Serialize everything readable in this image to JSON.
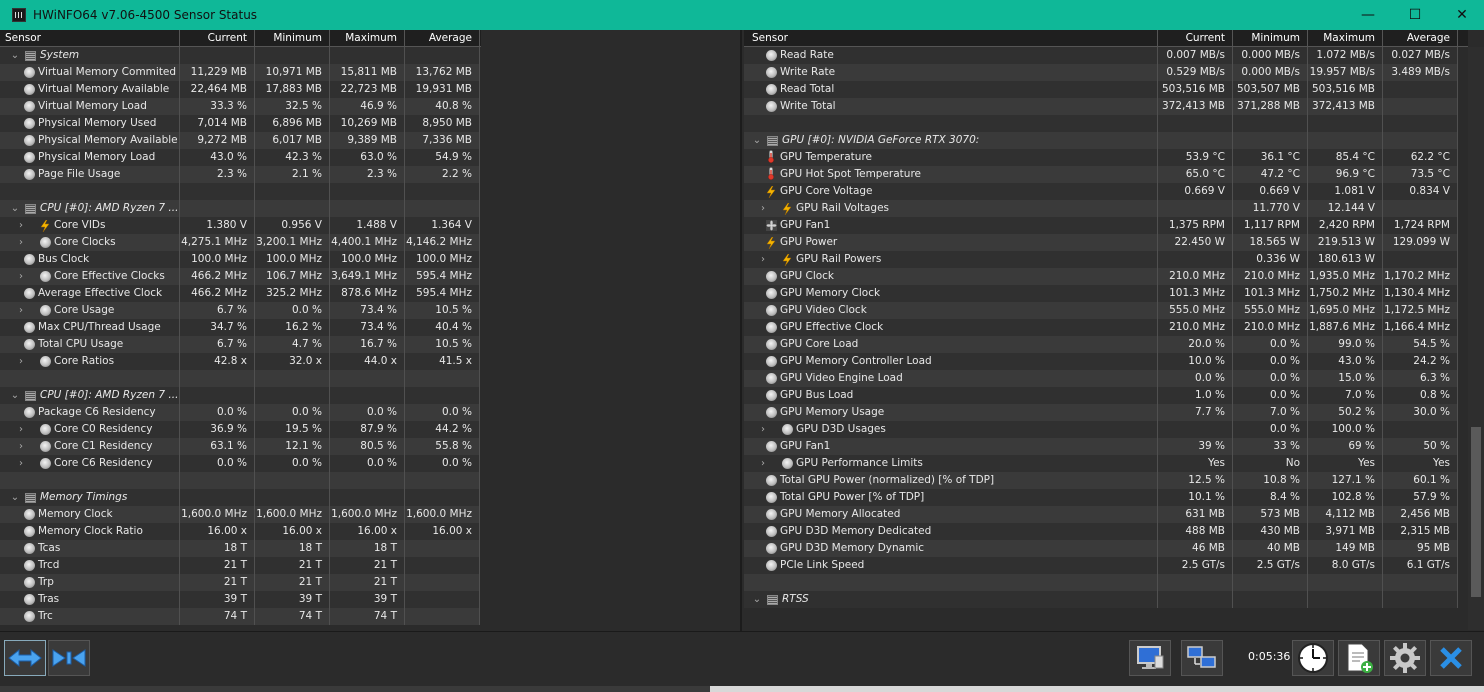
{
  "window": {
    "title": "HWiNFO64 v7.06-4500 Sensor Status",
    "minimize": "—",
    "maximize": "☐",
    "close": "✕"
  },
  "columns": {
    "sensor": "Sensor",
    "current": "Current",
    "minimum": "Minimum",
    "maximum": "Maximum",
    "average": "Average"
  },
  "left_rows": [
    {
      "type": "group",
      "name": "System"
    },
    {
      "type": "item",
      "icon": "clock",
      "name": "Virtual Memory Commited",
      "cur": "11,229 MB",
      "min": "10,971 MB",
      "max": "15,811 MB",
      "avg": "13,762 MB"
    },
    {
      "type": "item",
      "icon": "clock",
      "name": "Virtual Memory Available",
      "cur": "22,464 MB",
      "min": "17,883 MB",
      "max": "22,723 MB",
      "avg": "19,931 MB"
    },
    {
      "type": "item",
      "icon": "clock",
      "name": "Virtual Memory Load",
      "cur": "33.3 %",
      "min": "32.5 %",
      "max": "46.9 %",
      "avg": "40.8 %"
    },
    {
      "type": "item",
      "icon": "clock",
      "name": "Physical Memory Used",
      "cur": "7,014 MB",
      "min": "6,896 MB",
      "max": "10,269 MB",
      "avg": "8,950 MB"
    },
    {
      "type": "item",
      "icon": "clock",
      "name": "Physical Memory Available",
      "cur": "9,272 MB",
      "min": "6,017 MB",
      "max": "9,389 MB",
      "avg": "7,336 MB"
    },
    {
      "type": "item",
      "icon": "clock",
      "name": "Physical Memory Load",
      "cur": "43.0 %",
      "min": "42.3 %",
      "max": "63.0 %",
      "avg": "54.9 %"
    },
    {
      "type": "item",
      "icon": "clock",
      "name": "Page File Usage",
      "cur": "2.3 %",
      "min": "2.1 %",
      "max": "2.3 %",
      "avg": "2.2 %"
    },
    {
      "type": "blank"
    },
    {
      "type": "group",
      "name": "CPU [#0]: AMD Ryzen 7 ..."
    },
    {
      "type": "sub",
      "icon": "bolt",
      "name": "Core VIDs",
      "cur": "1.380 V",
      "min": "0.956 V",
      "max": "1.488 V",
      "avg": "1.364 V"
    },
    {
      "type": "sub",
      "icon": "clock",
      "name": "Core Clocks",
      "cur": "4,275.1 MHz",
      "min": "3,200.1 MHz",
      "max": "4,400.1 MHz",
      "avg": "4,146.2 MHz"
    },
    {
      "type": "item",
      "icon": "clock",
      "name": "Bus Clock",
      "cur": "100.0 MHz",
      "min": "100.0 MHz",
      "max": "100.0 MHz",
      "avg": "100.0 MHz"
    },
    {
      "type": "sub",
      "icon": "clock",
      "name": "Core Effective Clocks",
      "cur": "466.2 MHz",
      "min": "106.7 MHz",
      "max": "3,649.1 MHz",
      "avg": "595.4 MHz"
    },
    {
      "type": "item",
      "icon": "clock",
      "name": "Average Effective Clock",
      "cur": "466.2 MHz",
      "min": "325.2 MHz",
      "max": "878.6 MHz",
      "avg": "595.4 MHz"
    },
    {
      "type": "sub",
      "icon": "clock",
      "name": "Core Usage",
      "cur": "6.7 %",
      "min": "0.0 %",
      "max": "73.4 %",
      "avg": "10.5 %"
    },
    {
      "type": "item",
      "icon": "clock",
      "name": "Max CPU/Thread Usage",
      "cur": "34.7 %",
      "min": "16.2 %",
      "max": "73.4 %",
      "avg": "40.4 %"
    },
    {
      "type": "item",
      "icon": "clock",
      "name": "Total CPU Usage",
      "cur": "6.7 %",
      "min": "4.7 %",
      "max": "16.7 %",
      "avg": "10.5 %"
    },
    {
      "type": "sub",
      "icon": "clock",
      "name": "Core Ratios",
      "cur": "42.8 x",
      "min": "32.0 x",
      "max": "44.0 x",
      "avg": "41.5 x"
    },
    {
      "type": "blank"
    },
    {
      "type": "group",
      "name": "CPU [#0]: AMD Ryzen 7 ..."
    },
    {
      "type": "item",
      "icon": "clock",
      "name": "Package C6 Residency",
      "cur": "0.0 %",
      "min": "0.0 %",
      "max": "0.0 %",
      "avg": "0.0 %"
    },
    {
      "type": "sub",
      "icon": "clock",
      "name": "Core C0 Residency",
      "cur": "36.9 %",
      "min": "19.5 %",
      "max": "87.9 %",
      "avg": "44.2 %"
    },
    {
      "type": "sub",
      "icon": "clock",
      "name": "Core C1 Residency",
      "cur": "63.1 %",
      "min": "12.1 %",
      "max": "80.5 %",
      "avg": "55.8 %"
    },
    {
      "type": "sub",
      "icon": "clock",
      "name": "Core C6 Residency",
      "cur": "0.0 %",
      "min": "0.0 %",
      "max": "0.0 %",
      "avg": "0.0 %"
    },
    {
      "type": "blank"
    },
    {
      "type": "group",
      "name": "Memory Timings"
    },
    {
      "type": "item",
      "icon": "clock",
      "name": "Memory Clock",
      "cur": "1,600.0 MHz",
      "min": "1,600.0 MHz",
      "max": "1,600.0 MHz",
      "avg": "1,600.0 MHz"
    },
    {
      "type": "item",
      "icon": "clock",
      "name": "Memory Clock Ratio",
      "cur": "16.00 x",
      "min": "16.00 x",
      "max": "16.00 x",
      "avg": "16.00 x"
    },
    {
      "type": "item",
      "icon": "clock",
      "name": "Tcas",
      "cur": "18 T",
      "min": "18 T",
      "max": "18 T",
      "avg": ""
    },
    {
      "type": "item",
      "icon": "clock",
      "name": "Trcd",
      "cur": "21 T",
      "min": "21 T",
      "max": "21 T",
      "avg": ""
    },
    {
      "type": "item",
      "icon": "clock",
      "name": "Trp",
      "cur": "21 T",
      "min": "21 T",
      "max": "21 T",
      "avg": ""
    },
    {
      "type": "item",
      "icon": "clock",
      "name": "Tras",
      "cur": "39 T",
      "min": "39 T",
      "max": "39 T",
      "avg": ""
    },
    {
      "type": "item",
      "icon": "clock",
      "name": "Trc",
      "cur": "74 T",
      "min": "74 T",
      "max": "74 T",
      "avg": ""
    }
  ],
  "right_rows": [
    {
      "type": "item",
      "icon": "clock",
      "name": "Read Rate",
      "cur": "0.007 MB/s",
      "min": "0.000 MB/s",
      "max": "1.072 MB/s",
      "avg": "0.027 MB/s"
    },
    {
      "type": "item",
      "icon": "clock",
      "name": "Write Rate",
      "cur": "0.529 MB/s",
      "min": "0.000 MB/s",
      "max": "19.957 MB/s",
      "avg": "3.489 MB/s"
    },
    {
      "type": "item",
      "icon": "clock",
      "name": "Read Total",
      "cur": "503,516 MB",
      "min": "503,507 MB",
      "max": "503,516 MB",
      "avg": ""
    },
    {
      "type": "item",
      "icon": "clock",
      "name": "Write Total",
      "cur": "372,413 MB",
      "min": "371,288 MB",
      "max": "372,413 MB",
      "avg": ""
    },
    {
      "type": "blank"
    },
    {
      "type": "group",
      "name": "GPU [#0]: NVIDIA GeForce RTX 3070:"
    },
    {
      "type": "item",
      "icon": "therm",
      "name": "GPU Temperature",
      "cur": "53.9 °C",
      "min": "36.1 °C",
      "max": "85.4 °C",
      "avg": "62.2 °C"
    },
    {
      "type": "item",
      "icon": "therm",
      "name": "GPU Hot Spot Temperature",
      "cur": "65.0 °C",
      "min": "47.2 °C",
      "max": "96.9 °C",
      "avg": "73.5 °C"
    },
    {
      "type": "item",
      "icon": "bolt",
      "name": "GPU Core Voltage",
      "cur": "0.669 V",
      "min": "0.669 V",
      "max": "1.081 V",
      "avg": "0.834 V"
    },
    {
      "type": "sub",
      "icon": "bolt",
      "name": "GPU Rail Voltages",
      "cur": "",
      "min": "11.770 V",
      "max": "12.144 V",
      "avg": ""
    },
    {
      "type": "item",
      "icon": "fan",
      "name": "GPU Fan1",
      "cur": "1,375 RPM",
      "min": "1,117 RPM",
      "max": "2,420 RPM",
      "avg": "1,724 RPM"
    },
    {
      "type": "item",
      "icon": "bolt",
      "name": "GPU Power",
      "cur": "22.450 W",
      "min": "18.565 W",
      "max": "219.513 W",
      "avg": "129.099 W"
    },
    {
      "type": "sub",
      "icon": "bolt",
      "name": "GPU Rail Powers",
      "cur": "",
      "min": "0.336 W",
      "max": "180.613 W",
      "avg": ""
    },
    {
      "type": "item",
      "icon": "clock",
      "name": "GPU Clock",
      "cur": "210.0 MHz",
      "min": "210.0 MHz",
      "max": "1,935.0 MHz",
      "avg": "1,170.2 MHz"
    },
    {
      "type": "item",
      "icon": "clock",
      "name": "GPU Memory Clock",
      "cur": "101.3 MHz",
      "min": "101.3 MHz",
      "max": "1,750.2 MHz",
      "avg": "1,130.4 MHz"
    },
    {
      "type": "item",
      "icon": "clock",
      "name": "GPU Video Clock",
      "cur": "555.0 MHz",
      "min": "555.0 MHz",
      "max": "1,695.0 MHz",
      "avg": "1,172.5 MHz"
    },
    {
      "type": "item",
      "icon": "clock",
      "name": "GPU Effective Clock",
      "cur": "210.0 MHz",
      "min": "210.0 MHz",
      "max": "1,887.6 MHz",
      "avg": "1,166.4 MHz"
    },
    {
      "type": "item",
      "icon": "clock",
      "name": "GPU Core Load",
      "cur": "20.0 %",
      "min": "0.0 %",
      "max": "99.0 %",
      "avg": "54.5 %"
    },
    {
      "type": "item",
      "icon": "clock",
      "name": "GPU Memory Controller Load",
      "cur": "10.0 %",
      "min": "0.0 %",
      "max": "43.0 %",
      "avg": "24.2 %"
    },
    {
      "type": "item",
      "icon": "clock",
      "name": "GPU Video Engine Load",
      "cur": "0.0 %",
      "min": "0.0 %",
      "max": "15.0 %",
      "avg": "6.3 %"
    },
    {
      "type": "item",
      "icon": "clock",
      "name": "GPU Bus Load",
      "cur": "1.0 %",
      "min": "0.0 %",
      "max": "7.0 %",
      "avg": "0.8 %"
    },
    {
      "type": "item",
      "icon": "clock",
      "name": "GPU Memory Usage",
      "cur": "7.7 %",
      "min": "7.0 %",
      "max": "50.2 %",
      "avg": "30.0 %"
    },
    {
      "type": "sub",
      "icon": "clock",
      "name": "GPU D3D Usages",
      "cur": "",
      "min": "0.0 %",
      "max": "100.0 %",
      "avg": ""
    },
    {
      "type": "item",
      "icon": "clock",
      "name": "GPU Fan1",
      "cur": "39 %",
      "min": "33 %",
      "max": "69 %",
      "avg": "50 %"
    },
    {
      "type": "sub",
      "icon": "clock",
      "name": "GPU Performance Limits",
      "cur": "Yes",
      "min": "No",
      "max": "Yes",
      "avg": "Yes"
    },
    {
      "type": "item",
      "icon": "clock",
      "name": "Total GPU Power (normalized) [% of TDP]",
      "cur": "12.5 %",
      "min": "10.8 %",
      "max": "127.1 %",
      "avg": "60.1 %"
    },
    {
      "type": "item",
      "icon": "clock",
      "name": "Total GPU Power [% of TDP]",
      "cur": "10.1 %",
      "min": "8.4 %",
      "max": "102.8 %",
      "avg": "57.9 %"
    },
    {
      "type": "item",
      "icon": "clock",
      "name": "GPU Memory Allocated",
      "cur": "631 MB",
      "min": "573 MB",
      "max": "4,112 MB",
      "avg": "2,456 MB"
    },
    {
      "type": "item",
      "icon": "clock",
      "name": "GPU D3D Memory Dedicated",
      "cur": "488 MB",
      "min": "430 MB",
      "max": "3,971 MB",
      "avg": "2,315 MB"
    },
    {
      "type": "item",
      "icon": "clock",
      "name": "GPU D3D Memory Dynamic",
      "cur": "46 MB",
      "min": "40 MB",
      "max": "149 MB",
      "avg": "95 MB"
    },
    {
      "type": "item",
      "icon": "clock",
      "name": "PCIe Link Speed",
      "cur": "2.5 GT/s",
      "min": "2.5 GT/s",
      "max": "8.0 GT/s",
      "avg": "6.1 GT/s"
    },
    {
      "type": "blank"
    },
    {
      "type": "group",
      "name": "RTSS"
    }
  ],
  "toolbar": {
    "elapsed": "0:05:36"
  },
  "colors": {
    "titlebar": "#0fb898",
    "bolt": "#f5b400",
    "therm": "#e08a2a",
    "close_x": "#2a8fe6"
  }
}
